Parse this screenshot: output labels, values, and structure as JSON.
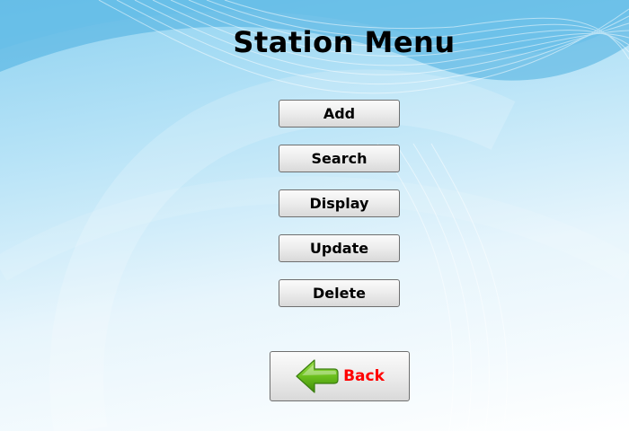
{
  "window": {
    "title": "Station Menu"
  },
  "menu": {
    "buttons": [
      {
        "label": "Add"
      },
      {
        "label": "Search"
      },
      {
        "label": "Display"
      },
      {
        "label": "Update"
      },
      {
        "label": "Delete"
      }
    ]
  },
  "back": {
    "label": "Back",
    "icon": "arrow-left-icon",
    "label_color": "#ff0000",
    "icon_color": "#6cc01e"
  },
  "colors": {
    "background_top": "#8fd2f0",
    "background_bottom": "#ffffff"
  }
}
